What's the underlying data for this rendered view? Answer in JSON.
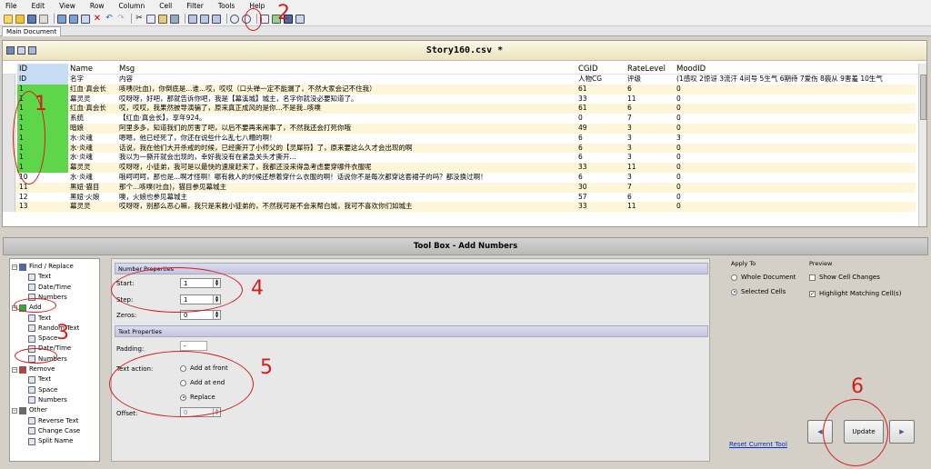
{
  "menu": [
    "File",
    "Edit",
    "View",
    "Row",
    "Column",
    "Cell",
    "Filter",
    "Tools",
    "Help"
  ],
  "tab": "Main Document",
  "grid": {
    "title": "Story160.csv *",
    "columns": [
      "ID",
      "Name",
      "Msg",
      "CGID",
      "RateLevel",
      "MoodID"
    ],
    "rows": [
      [
        "ID",
        "名字",
        "内容",
        "人物CG",
        "评级",
        "(1感叹 2惊讶 3流汗 4问号 5生气 6期待 7爱伤 8藐从 9害羞 10生气"
      ],
      [
        "1",
        "红血·真会长",
        "咳咦(吐血)，你倒底是...谁...哎，哎哎（口头禅一定不能漏了，不然大家会记不住我）",
        "61",
        "6",
        "0"
      ],
      [
        "1",
        "幕灵灵",
        "哎呀呀，好吧，那就告诉你吧，我是【幕溪城】城主，名字你就没必要知道了。",
        "33",
        "11",
        "0"
      ],
      [
        "1",
        "红血·真会长",
        "哎，哎哎，我果然被导演骗了，原来真正成风的是你...不是我..咳噗",
        "61",
        "6",
        "0"
      ],
      [
        "1",
        "系统",
        "【红血·真会长】，享年924。",
        "0",
        "7",
        "0"
      ],
      [
        "1",
        "暗娘",
        "阿里多多，知道我们的厉害了吧，以后不要再来闹事了，不然我还会打死你哦",
        "49",
        "3",
        "0"
      ],
      [
        "1",
        "水·炎魂",
        "嗯嗯，他已经死了，你还在说些什么乱七八糟的啊！",
        "6",
        "3",
        "3"
      ],
      [
        "1",
        "水·炎魂",
        "话说，我在他们大开杀戒的时候，已经撕开了小师父的【灵犀符】了，原来要这么久才会出现的啊",
        "6",
        "3",
        "0"
      ],
      [
        "1",
        "水·炎魂",
        "我以为一撕开就会出现的，幸好我没有在紧急关头才撕开...",
        "6",
        "3",
        "0"
      ],
      [
        "1",
        "幕灵灵",
        "哎呀呀，小徒弟，我可是以最快的速度赶来了，我都还没来得急考虑要穿哪件衣服呢",
        "33",
        "11",
        "0"
      ],
      [
        "10",
        "水·炎魂",
        "哦呵呵呵，那也是...啊才怪啊！哪有救人的时候还想着穿什么衣服的啊！话说你不是每次都穿这套裙子的吗？都没换过啊！",
        "6",
        "3",
        "0"
      ],
      [
        "11",
        "黑妞·猫目",
        "那个...咳噗(吐血)，猫目参见幕城主",
        "30",
        "7",
        "0"
      ],
      [
        "12",
        "黑妞·火娘",
        "噢，火娘也参见幕城主",
        "57",
        "6",
        "0"
      ],
      [
        "13",
        "幕灵灵",
        "哎呀呀，别那么恶心嘛，我只是来救小徒弟的，不然我可是不会来帮白城，我可不喜欢你们如城主",
        "33",
        "11",
        "0"
      ]
    ]
  },
  "toolbox": {
    "title": "Tool Box - Add Numbers",
    "tree": [
      {
        "label": "Find / Replace",
        "level": 0,
        "icon": "binoculars-icon"
      },
      {
        "label": "Text",
        "level": 1,
        "icon": "page-icon"
      },
      {
        "label": "Date/Time",
        "level": 1,
        "icon": "page-icon"
      },
      {
        "label": "Numbers",
        "level": 1,
        "icon": "page-icon"
      },
      {
        "label": "Add",
        "level": 0,
        "icon": "plus-icon"
      },
      {
        "label": "Text",
        "level": 1,
        "icon": "page-icon"
      },
      {
        "label": "Random Text",
        "level": 1,
        "icon": "page-icon"
      },
      {
        "label": "Space",
        "level": 1,
        "icon": "page-icon"
      },
      {
        "label": "Date/Time",
        "level": 1,
        "icon": "page-icon"
      },
      {
        "label": "Numbers",
        "level": 1,
        "icon": "page-icon"
      },
      {
        "label": "Remove",
        "level": 0,
        "icon": "x-icon"
      },
      {
        "label": "Text",
        "level": 1,
        "icon": "page-icon"
      },
      {
        "label": "Space",
        "level": 1,
        "icon": "page-icon"
      },
      {
        "label": "Numbers",
        "level": 1,
        "icon": "page-icon"
      },
      {
        "label": "Other",
        "level": 0,
        "icon": "gear-icon"
      },
      {
        "label": "Reverse Text",
        "level": 1,
        "icon": "page-icon"
      },
      {
        "label": "Change Case",
        "level": 1,
        "icon": "page-icon"
      },
      {
        "label": "Split Name",
        "level": 1,
        "icon": "page-icon"
      }
    ],
    "number_properties": "Number Properties",
    "start_label": "Start:",
    "start_value": "1",
    "step_label": "Step:",
    "step_value": "1",
    "zeros_label": "Zeros:",
    "zeros_value": "0",
    "text_properties": "Text Properties",
    "padding_label": "Padding:",
    "padding_value": "-",
    "text_action_label": "Text action:",
    "text_actions": [
      "Add at front",
      "Add at end",
      "Replace"
    ],
    "text_action_selected": 2,
    "offset_label": "Offset:",
    "offset_value": "0",
    "apply_to_label": "Apply To",
    "apply_to_options": [
      "Whole Document",
      "Selected Cells"
    ],
    "apply_to_selected": 1,
    "preview_label": "Preview",
    "show_cell_changes": "Show Cell Changes",
    "highlight_matching": "Highlight Matching Cell(s)",
    "reset_link": "Reset Current Tool",
    "update_button": "Update"
  },
  "annotations": [
    "1",
    "2",
    "3",
    "4",
    "5",
    "6"
  ],
  "colors": {
    "annotation": "#d21e1e",
    "selected_cell": "#5dd64a",
    "row_alt": "#fdf6d8",
    "row_selected": "#c6dcf4"
  }
}
